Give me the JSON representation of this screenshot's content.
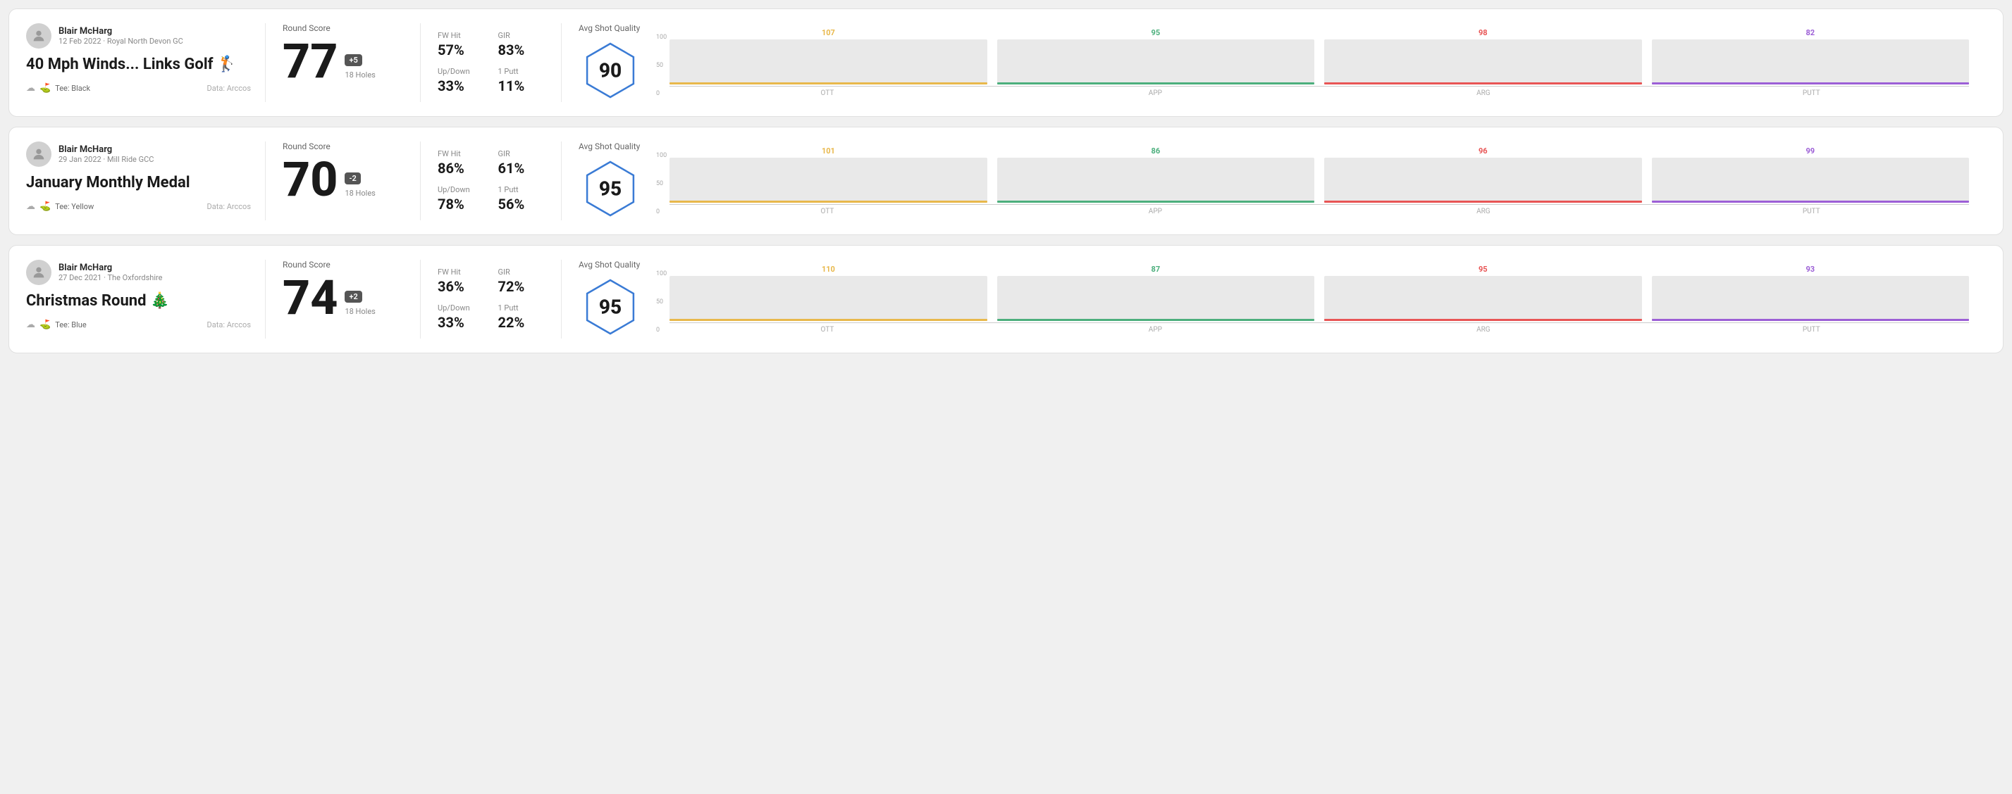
{
  "rounds": [
    {
      "id": "round1",
      "user": {
        "name": "Blair McHarg",
        "date_course": "12 Feb 2022 · Royal North Devon GC"
      },
      "title": "40 Mph Winds... Links Golf 🏌",
      "tee": "Black",
      "data_source": "Data: Arccos",
      "round_score_label": "Round Score",
      "score": "77",
      "badge": "+5",
      "badge_type": "positive",
      "holes": "18 Holes",
      "fw_hit_label": "FW Hit",
      "fw_hit_value": "57%",
      "gir_label": "GIR",
      "gir_value": "83%",
      "updown_label": "Up/Down",
      "updown_value": "33%",
      "putt_label": "1 Putt",
      "putt_value": "11%",
      "avg_quality_label": "Avg Shot Quality",
      "quality_score": "90",
      "chart": {
        "bars": [
          {
            "label": "OTT",
            "value": 107,
            "color": "#e8b84b",
            "height_pct": 72
          },
          {
            "label": "APP",
            "value": 95,
            "color": "#4caf7d",
            "height_pct": 64
          },
          {
            "label": "ARG",
            "value": 98,
            "color": "#e85555",
            "height_pct": 66
          },
          {
            "label": "PUTT",
            "value": 82,
            "color": "#9c5fd6",
            "height_pct": 55
          }
        ],
        "y_labels": [
          "100",
          "50",
          "0"
        ]
      }
    },
    {
      "id": "round2",
      "user": {
        "name": "Blair McHarg",
        "date_course": "29 Jan 2022 · Mill Ride GCC"
      },
      "title": "January Monthly Medal",
      "tee": "Yellow",
      "data_source": "Data: Arccos",
      "round_score_label": "Round Score",
      "score": "70",
      "badge": "-2",
      "badge_type": "negative",
      "holes": "18 Holes",
      "fw_hit_label": "FW Hit",
      "fw_hit_value": "86%",
      "gir_label": "GIR",
      "gir_value": "61%",
      "updown_label": "Up/Down",
      "updown_value": "78%",
      "putt_label": "1 Putt",
      "putt_value": "56%",
      "avg_quality_label": "Avg Shot Quality",
      "quality_score": "95",
      "chart": {
        "bars": [
          {
            "label": "OTT",
            "value": 101,
            "color": "#e8b84b",
            "height_pct": 68
          },
          {
            "label": "APP",
            "value": 86,
            "color": "#4caf7d",
            "height_pct": 58
          },
          {
            "label": "ARG",
            "value": 96,
            "color": "#e85555",
            "height_pct": 65
          },
          {
            "label": "PUTT",
            "value": 99,
            "color": "#9c5fd6",
            "height_pct": 67
          }
        ],
        "y_labels": [
          "100",
          "50",
          "0"
        ]
      }
    },
    {
      "id": "round3",
      "user": {
        "name": "Blair McHarg",
        "date_course": "27 Dec 2021 · The Oxfordshire"
      },
      "title": "Christmas Round 🎄",
      "tee": "Blue",
      "data_source": "Data: Arccos",
      "round_score_label": "Round Score",
      "score": "74",
      "badge": "+2",
      "badge_type": "positive",
      "holes": "18 Holes",
      "fw_hit_label": "FW Hit",
      "fw_hit_value": "36%",
      "gir_label": "GIR",
      "gir_value": "72%",
      "updown_label": "Up/Down",
      "updown_value": "33%",
      "putt_label": "1 Putt",
      "putt_value": "22%",
      "avg_quality_label": "Avg Shot Quality",
      "quality_score": "95",
      "chart": {
        "bars": [
          {
            "label": "OTT",
            "value": 110,
            "color": "#e8b84b",
            "height_pct": 74
          },
          {
            "label": "APP",
            "value": 87,
            "color": "#4caf7d",
            "height_pct": 59
          },
          {
            "label": "ARG",
            "value": 95,
            "color": "#e85555",
            "height_pct": 64
          },
          {
            "label": "PUTT",
            "value": 93,
            "color": "#9c5fd6",
            "height_pct": 63
          }
        ],
        "y_labels": [
          "100",
          "50",
          "0"
        ]
      }
    }
  ]
}
